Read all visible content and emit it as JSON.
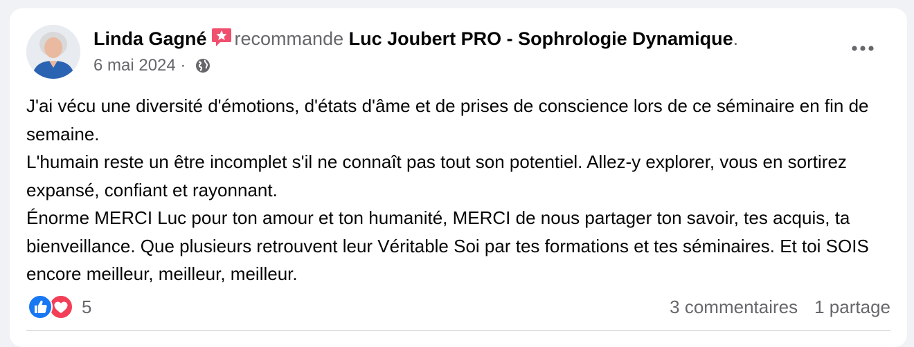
{
  "post": {
    "author": "Linda Gagné",
    "badge_icon": "star-badge-icon",
    "verb": "recommande",
    "page": "Luc Joubert PRO - Sophrologie Dynamique",
    "period": ".",
    "date": "6 mai 2024",
    "separator": "·",
    "audience_icon": "globe-icon",
    "more_icon": "more-options-icon",
    "paragraphs": [
      "J'ai vécu une diversité d'émotions, d'états d'âme et de prises de conscience lors de ce séminaire en fin de semaine.",
      "L'humain reste un être incomplet s'il ne connaît pas tout son potentiel. Allez-y explorer, vous en sortirez expansé, confiant et rayonnant.",
      "Énorme MERCI Luc pour ton amour et ton humanité, MERCI de nous partager ton savoir, tes acquis, ta bienveillance. Que plusieurs retrouvent leur Véritable Soi par tes formations et tes séminaires. Et toi SOIS encore meilleur, meilleur, meilleur."
    ],
    "reactions": {
      "icons": [
        "like-icon",
        "love-icon"
      ],
      "count": "5"
    },
    "comments": "3 commentaires",
    "shares": "1 partage"
  },
  "colors": {
    "like": "#1877f2",
    "love": "#f33e58",
    "badge": "#f0506e",
    "secondary_text": "#65676b",
    "primary_text": "#050505"
  }
}
